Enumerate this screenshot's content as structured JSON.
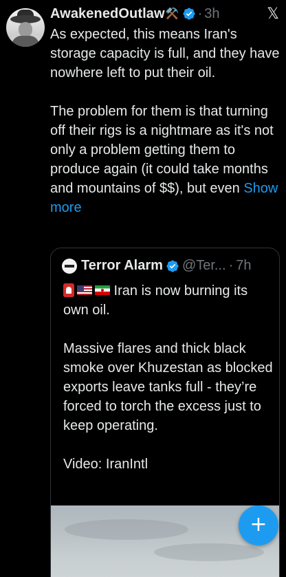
{
  "author": {
    "name": "AwakenedOutlaw",
    "emoji": "⚒️",
    "separator": "·",
    "time": "3h"
  },
  "tweet": {
    "text": "As expected, this means Iran's storage capacity is full, and they have nowhere left to put their oil.\n\nThe problem for them is that turning off their rigs is a nightmare as it's not only a problem getting them to produce again (it could take months and mountains of $$), but even ",
    "show_more": "Show more"
  },
  "quote": {
    "name": "Terror Alarm",
    "handle": "@Ter...",
    "separator": "·",
    "time": "7h",
    "text": " Iran is now burning its own oil.\n\nMassive flares and thick black smoke over Khuzestan as blocked exports leave tanks full - they’re forced to torch the excess just to keep operating.\n\nVideo: IranIntl"
  },
  "icons": {
    "close": "𝕏",
    "fab": "+"
  },
  "colors": {
    "background": "#000000",
    "text": "#e7e9ea",
    "muted": "#71767b",
    "accent": "#1d9bf0",
    "border": "#2f3336"
  }
}
